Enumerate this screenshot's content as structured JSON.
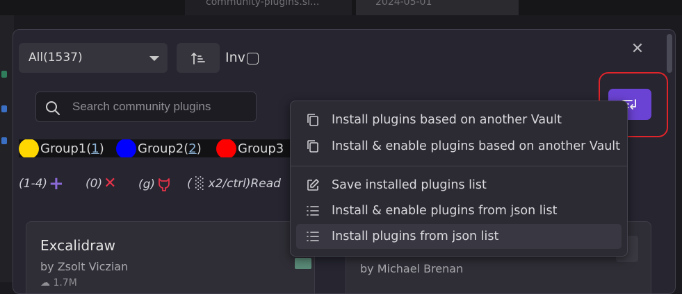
{
  "background": {
    "tab1_text": "community-plugins.sl...",
    "tab2_text": "2024-05-01"
  },
  "filter_select": {
    "value": "All(1537)"
  },
  "invert": {
    "label": "Inv"
  },
  "search": {
    "placeholder": "Search community plugins"
  },
  "groups": [
    {
      "color": "#ffd700",
      "name": "Group1",
      "count": "1"
    },
    {
      "color": "#0000ff",
      "name": "Group2",
      "count": "2"
    },
    {
      "color": "#ff0000",
      "name": "Group3",
      "count": ""
    }
  ],
  "hints": {
    "add": "(1-4)",
    "remove": "(0)",
    "github": "(g)",
    "read": "( ░ x2/ctrl)Read"
  },
  "cards": [
    {
      "title": "Excalidraw",
      "author": "by Zsolt Viczian",
      "downloads": "1.7M"
    },
    {
      "title": "",
      "author": "by Michael Brenan",
      "downloads": ""
    }
  ],
  "menu": {
    "items": [
      {
        "label": "Install plugins based on another Vault",
        "icon": "copy-icon"
      },
      {
        "label": "Install & enable plugins based on another Vault",
        "icon": "copy-icon"
      },
      {
        "label": "Save installed plugins list",
        "icon": "edit-icon"
      },
      {
        "label": "Install & enable plugins from json list",
        "icon": "list-icon"
      },
      {
        "label": "Install plugins from json list",
        "icon": "list-icon"
      }
    ]
  },
  "colors": {
    "accent": "#6b43d4",
    "highlight_box": "#e0242a",
    "add_icon": "#8b6ad8",
    "remove_icon": "#e8334a",
    "github_icon": "#e8334a"
  }
}
